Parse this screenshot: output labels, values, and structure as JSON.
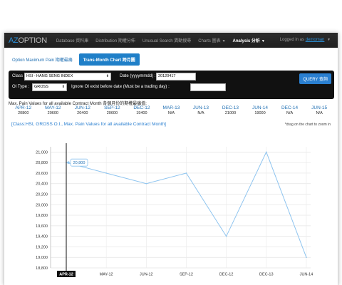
{
  "navbar": {
    "brand_az": "AZ",
    "brand_option": "OPTION",
    "items": [
      {
        "label": "Database 資料庫"
      },
      {
        "label": "Distribution 期權分佈"
      },
      {
        "label": "Unusual Search 異動搜尋"
      },
      {
        "label": "Charts 圖表"
      },
      {
        "label": "Analysis 分析"
      }
    ],
    "login_prefix": "Logged in as",
    "username": "demoman"
  },
  "tabs": {
    "max_pain_label": "Option Maximum Pain 期權最痛",
    "trans_month_label": "Trans-Month Chart 跨月圖"
  },
  "form": {
    "class_label": "Class :",
    "class_value": "HSI - HANG SENG INDEX",
    "date_label": "Date (yyyymmdd) :",
    "date_value": "20120417",
    "oi_type_label": "OI Type :",
    "oi_type_value": "GROSS",
    "oi_exist_label": "Ignore OI exist before date (Must be a trading day) :",
    "oi_exist_value": "",
    "query_label": "QUERY 查詢"
  },
  "max_pain": {
    "title": "Max. Pain Values for all available Contract Month 各個月份的期權最痛值:",
    "months": [
      "APR-12",
      "MAY-12",
      "JUN-12",
      "SEP-12",
      "DEC-12",
      "MAR-13",
      "JUN-13",
      "DEC-13",
      "JUN-14",
      "DEC-14",
      "JUN-15"
    ],
    "values": [
      "20800",
      "20600",
      "20400",
      "20600",
      "19400",
      "N/A",
      "N/A",
      "21000",
      "19000",
      "N/A",
      "N/A"
    ]
  },
  "chart": {
    "title": "[Class:HSI, GROSS O.I., Max. Pain Values for all available Contract Month]",
    "hint": "*drag on the chart to zoom in",
    "tooltip": "20,800",
    "line_color": "#8ec4ef"
  },
  "chart_data": {
    "type": "line",
    "title": "[Class:HSI, GROSS O.I., Max. Pain Values for all available Contract Month]",
    "categories": [
      "APR-12",
      "MAY-12",
      "JUN-12",
      "SEP-12",
      "DEC-12",
      "DEC-13",
      "JUN-14"
    ],
    "values": [
      20800,
      20600,
      20400,
      20600,
      19400,
      21000,
      19000
    ],
    "yticks": [
      "21,000",
      "20,800",
      "20,600",
      "20,400",
      "20,200",
      "20,000",
      "19,800",
      "19,600",
      "19,400",
      "19,200",
      "19,000",
      "18,800"
    ],
    "ylim": [
      18800,
      21100
    ],
    "grid": true,
    "highlight_category": "APR-12"
  }
}
